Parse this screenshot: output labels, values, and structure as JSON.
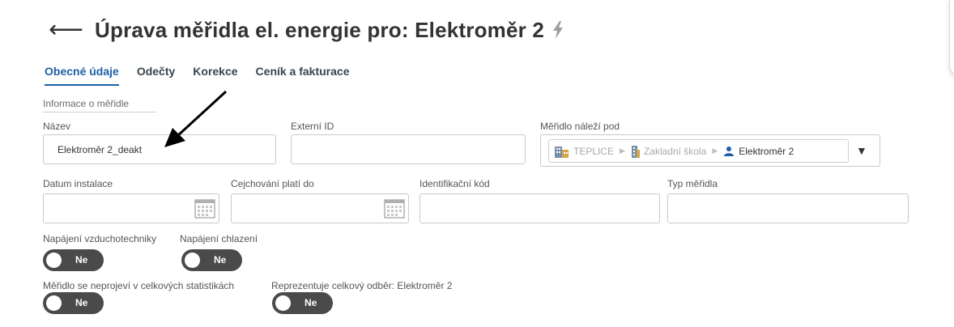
{
  "header": {
    "back_icon": "arrow-left-icon",
    "title": "Úprava měřidla el. energie pro: Elektroměr 2",
    "title_icon": "bolt-icon"
  },
  "tabs": [
    {
      "label": "Obecné údaje",
      "active": true
    },
    {
      "label": "Odečty",
      "active": false
    },
    {
      "label": "Korekce",
      "active": false
    },
    {
      "label": "Ceník a fakturace",
      "active": false
    }
  ],
  "section": {
    "title": "Informace o měřidle"
  },
  "fields": {
    "nazev": {
      "label": "Název",
      "value": "Elektroměr 2_deakt"
    },
    "externi_id": {
      "label": "Externí ID",
      "value": ""
    },
    "meridlo_nalezi_pod": {
      "label": "Měřidlo náleží pod",
      "path": [
        {
          "label": "TEPLICE",
          "icon": "building-icon"
        },
        {
          "label": "Zakladní škola",
          "icon": "building-icon"
        },
        {
          "label": "Elektroměr 2",
          "icon": "user-icon"
        }
      ]
    },
    "datum_instalace": {
      "label": "Datum instalace",
      "value": ""
    },
    "cejchovani": {
      "label": "Cejchování platí do",
      "value": ""
    },
    "identifikacni_kod": {
      "label": "Identifikační kód",
      "value": ""
    },
    "typ_meridla": {
      "label": "Typ měřidla",
      "value": ""
    }
  },
  "toggles": {
    "napajeni_vzduchotechniky": {
      "label": "Napájení vzduchotechniky",
      "value": "Ne"
    },
    "napajeni_chlazeni": {
      "label": "Napájení chlazení",
      "value": "Ne"
    },
    "neprojevi_statistiky": {
      "label": "Měřidlo se neprojeví v celkových statistikách",
      "value": "Ne"
    },
    "reprezentuje_odber": {
      "label": "Reprezentuje celkový odběr: Elektroměr 2",
      "value": "Ne"
    }
  },
  "colors": {
    "accent": "#1f5fa6",
    "toggle_bg": "#4a4a4a",
    "bolt": "#9e9e9e"
  }
}
